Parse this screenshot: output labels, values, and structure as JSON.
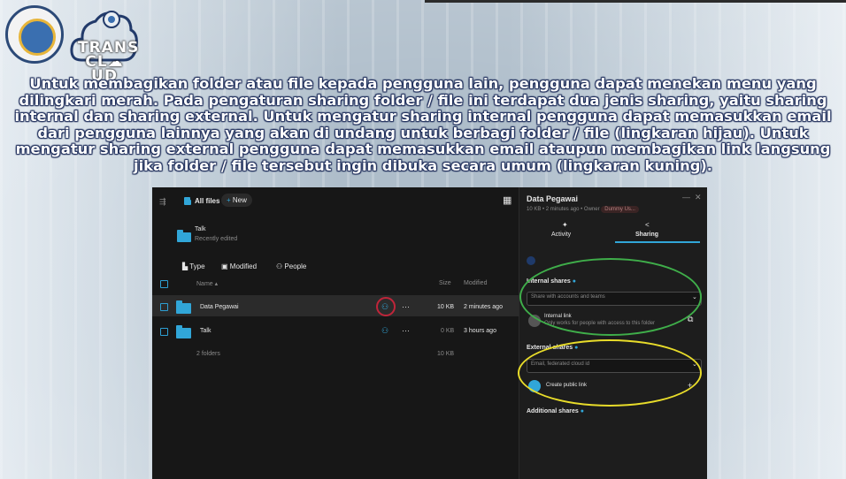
{
  "logo": {
    "trans_cloud_line1": "TRANS",
    "trans_cloud_line2": "CL☁UD"
  },
  "description": "Untuk membagikan folder atau file kepada pengguna lain, pengguna dapat menekan menu yang dilingkari merah. Pada pengaturan sharing folder / file ini terdapat dua jenis sharing, yaitu sharing internal dan sharing external. Untuk mengatur sharing internal pengguna dapat memasukkan email dari pengguna lainnya yang akan di undang untuk berbagi folder / file (lingkaran hijau). Untuk mengatur sharing external pengguna dapat memasukkan email ataupun membagikan link langsung jika folder / file tersebut ingin dibuka secara umum (lingkaran kuning).",
  "files": {
    "breadcrumb": "All files",
    "new_button": "New",
    "recent": {
      "name": "Talk",
      "sub": "Recently edited"
    },
    "filters": {
      "type": "Type",
      "modified": "Modified",
      "people": "People"
    },
    "columns": {
      "name": "Name",
      "size": "Size",
      "modified": "Modified"
    },
    "rows": [
      {
        "name": "Data Pegawai",
        "size": "10 KB",
        "modified": "2 minutes ago"
      },
      {
        "name": "Talk",
        "size": "0 KB",
        "modified": "3 hours ago"
      }
    ],
    "summary": {
      "count": "2 folders",
      "size": "10 KB"
    }
  },
  "sidebar": {
    "title": "Data Pegawai",
    "meta": "10 KB • 2 minutes ago • Owner",
    "owner": "Dummy Us...",
    "tabs": {
      "activity": "Activity",
      "sharing": "Sharing"
    },
    "internal": {
      "heading": "Internal shares",
      "placeholder": "Share with accounts and teams",
      "link_title": "Internal link",
      "link_sub": "Only works for people with access to this folder"
    },
    "external": {
      "heading": "External shares",
      "placeholder": "Email, federated cloud id",
      "public_link": "Create public link"
    },
    "additional": "Additional shares"
  },
  "colors": {
    "accent": "#31a6d8",
    "red_ring": "#c0253a",
    "green_ring": "#3fae4a",
    "yellow_ring": "#e8dc2a"
  }
}
